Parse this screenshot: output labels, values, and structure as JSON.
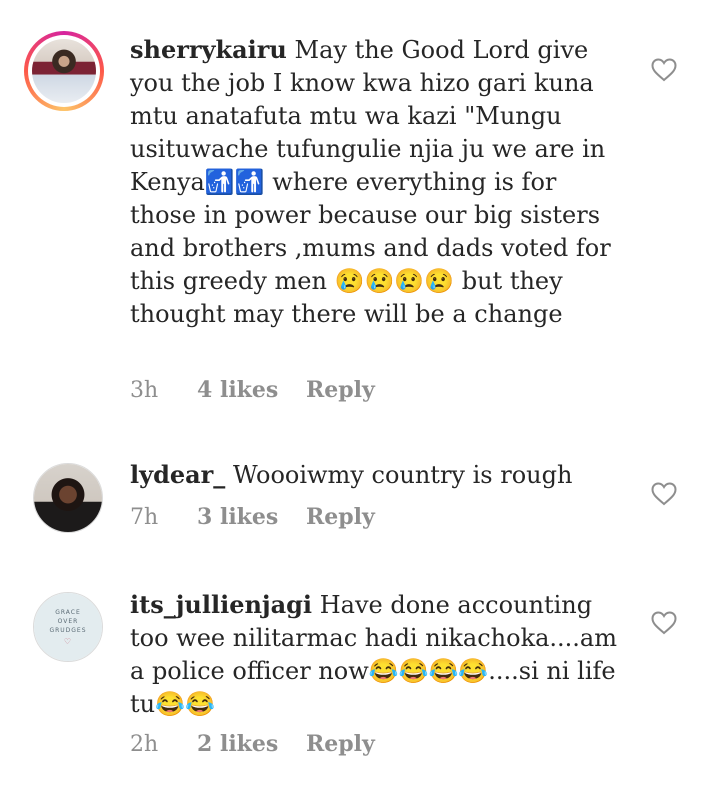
{
  "comments": [
    {
      "username": "sherrykairu",
      "text": "May the Good Lord give you the job I know kwa hizo gari kuna mtu anatafuta mtu wa kazi \"Mungu usituwache tufungulie njia ju we are in Kenya🚮🚮 where everything  is for those in power because  our big sisters and brothers ,mums and dads voted  for this greedy  men 😢😢😢😢 but they thought  may there will be a change",
      "time": "3h",
      "likes": "4 likes",
      "reply": "Reply",
      "avatar_icon": "user-avatar-story-ring"
    },
    {
      "username": "lydear_",
      "text": "Woooiwmy country is rough",
      "time": "7h",
      "likes": "3 likes",
      "reply": "Reply",
      "avatar_icon": "user-avatar"
    },
    {
      "username": "its_jullienjagi",
      "text": "Have done accounting too wee nilitarmac hadi nikachoka....am a police officer now😂😂😂😂....si ni life tu😂😂",
      "time": "2h",
      "likes": "2 likes",
      "reply": "Reply",
      "avatar_icon": "user-avatar",
      "avatar_text": [
        "GRACE",
        "OVER",
        "GRUDGES"
      ]
    }
  ],
  "icons": {
    "like": "heart-outline-icon"
  },
  "colors": {
    "meta": "#8e8e8e",
    "text": "#262626",
    "ring_start": "#d6249f",
    "ring_end": "#fdc468"
  }
}
